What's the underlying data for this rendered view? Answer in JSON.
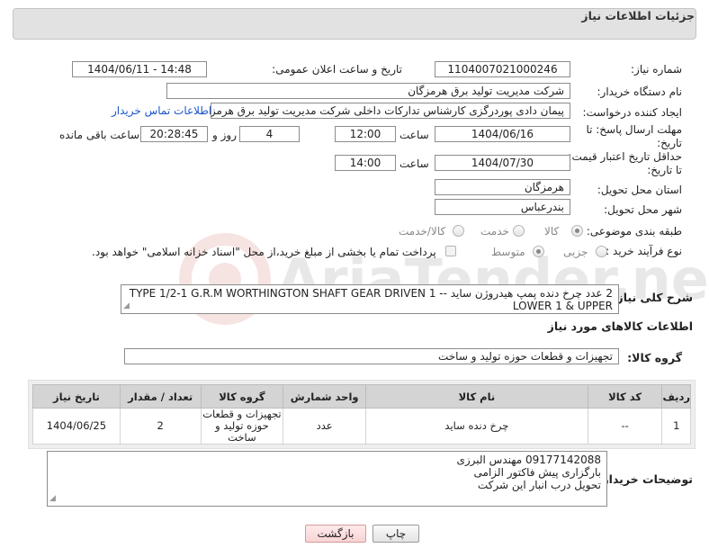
{
  "header": {
    "title": "جزئیات اطلاعات نیاز"
  },
  "form": {
    "need_number": {
      "label": "شماره نیاز:",
      "value": "1104007021000246"
    },
    "announce": {
      "label": "تاریخ و ساعت اعلان عمومی:",
      "value": "1404/06/11 - 14:48"
    },
    "buyer_org": {
      "label": "نام دستگاه خریدار:",
      "value": "شرکت مدیریت تولید برق هرمزگان"
    },
    "creator": {
      "label": "ایجاد کننده درخواست:",
      "value": "پیمان دادی پوردرگزی کارشناس تدارکات داخلی شرکت مدیریت تولید برق هرمزگا",
      "contact_link": "اطلاعات تماس خریدار"
    },
    "send_deadline": {
      "label_line1": "مهلت ارسال پاسخ: تا",
      "label_line2": "تاریخ:",
      "date": "1404/06/16",
      "time_label": "ساعت",
      "time": "12:00",
      "days": "4",
      "days_label": "روز و",
      "remaining": "20:28:45",
      "remaining_label": "ساعت باقی مانده"
    },
    "price_validity": {
      "label_line1": "حداقل تاریخ اعتبار قیمت:",
      "label_line2": "تا تاریخ:",
      "date": "1404/07/30",
      "time_label": "ساعت",
      "time": "14:00"
    },
    "province": {
      "label": "استان محل تحویل:",
      "value": "هرمزگان"
    },
    "city": {
      "label": "شهر محل تحویل:",
      "value": "بندرعباس"
    },
    "category": {
      "label": "طبقه بندی موضوعی:",
      "options": [
        "کالا",
        "خدمت",
        "کالا/خدمت"
      ],
      "selected": "کالا"
    },
    "process": {
      "label": "نوع فرآیند خرید :",
      "options": [
        "جزیی",
        "متوسط"
      ],
      "selected": "متوسط",
      "payment_note": "پرداخت تمام یا بخشی از مبلغ خرید،از محل \"اسناد خزانه اسلامی\" خواهد بود."
    }
  },
  "description": {
    "label": "شرح کلی نیاز:",
    "text": "2 عدد چرخ دنده پمپ هیدروژن ساید -- TYPE 1/2-1 G.R.M WORTHINGTON  SHAFT GEAR DRIVEN 1 LOWER 1 & UPPER"
  },
  "goods_section": {
    "title": "اطلاعات کالاهای مورد نیاز",
    "group_label": "گروه کالا:",
    "group_value": "تجهیزات و قطعات حوزه تولید و ساخت"
  },
  "table": {
    "headers": [
      "ردیف",
      "کد کالا",
      "نام کالا",
      "واحد شمارش",
      "گروه کالا",
      "تعداد / مقدار",
      "تاریخ نیاز"
    ],
    "rows": [
      {
        "row": "1",
        "code": "--",
        "name": "چرخ دنده ساید",
        "unit": "عدد",
        "group": "تجهیزات و قطعات حوزه تولید و ساخت",
        "qty": "2",
        "date": "1404/06/25"
      }
    ]
  },
  "buyer_notes": {
    "label": "توضیحات خریدار:",
    "lines": [
      "09177142088 مهندس البرزی",
      "بارگزاری پیش فاکتور الزامی",
      "تحویل درب انبار این شرکت"
    ]
  },
  "buttons": {
    "print": "چاپ",
    "back": "بازگشت"
  },
  "watermark": {
    "text": "AriaTender.neT"
  }
}
